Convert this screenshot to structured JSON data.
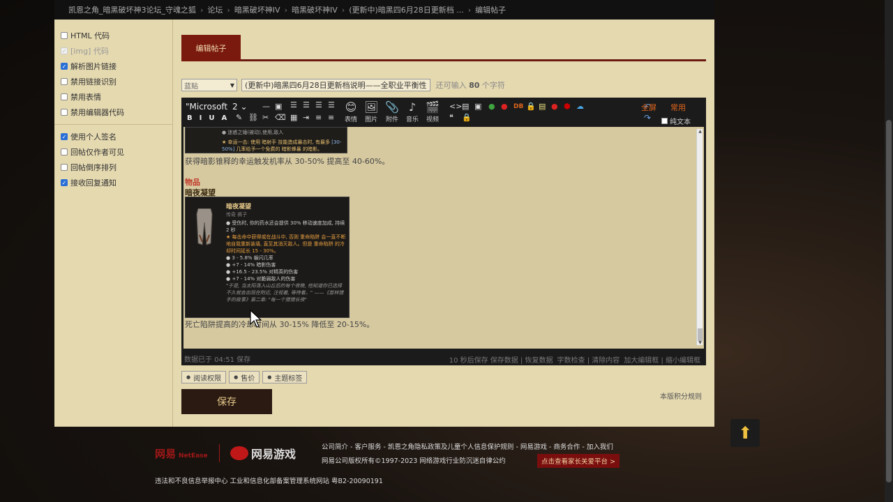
{
  "breadcrumb": {
    "items": [
      "凯恩之角_暗黑破坏神3论坛_守魂之狐",
      "论坛",
      "暗黑破坏神IV",
      "暗黑破坏神IV",
      "(更新中)暗黑四6月28日更新档 ...",
      "编辑帖子"
    ],
    "sep": "›"
  },
  "sidebar": {
    "options1": [
      {
        "label": "HTML 代码",
        "checked": false,
        "disabled": false
      },
      {
        "label": "[img] 代码",
        "checked": true,
        "disabled": true
      },
      {
        "label": "解析图片链接",
        "checked": true,
        "disabled": false
      },
      {
        "label": "禁用链接识别",
        "checked": false,
        "disabled": false
      },
      {
        "label": "禁用表情",
        "checked": false,
        "disabled": false
      },
      {
        "label": "禁用编辑器代码",
        "checked": false,
        "disabled": false
      }
    ],
    "options2": [
      {
        "label": "使用个人签名",
        "checked": true,
        "disabled": false
      },
      {
        "label": "回帖仅作者可见",
        "checked": false,
        "disabled": false
      },
      {
        "label": "回帖倒序排列",
        "checked": false,
        "disabled": false
      },
      {
        "label": "接收回复通知",
        "checked": true,
        "disabled": false
      }
    ]
  },
  "tab": {
    "label": "编辑帖子"
  },
  "subject": {
    "category": "蓝贴",
    "title": "(更新中)暗黑四6月28日更新档说明——全职业平衡性",
    "remain_prefix": "还可输入",
    "remain_count": "80",
    "remain_suffix": "个字符"
  },
  "toolbar": {
    "font": "\"Microsoft",
    "size": "2",
    "format": [
      "B",
      "I",
      "U",
      "A"
    ],
    "icons": [
      {
        "label": "表情",
        "glyph": "😊",
        "icon": "emoji-icon"
      },
      {
        "label": "图片",
        "glyph": "🖼",
        "icon": "image-icon"
      },
      {
        "label": "附件",
        "glyph": "📎",
        "icon": "attachment-icon"
      },
      {
        "label": "音乐",
        "glyph": "♪",
        "icon": "music-icon"
      },
      {
        "label": "视频",
        "glyph": "🎬",
        "icon": "video-icon"
      }
    ],
    "small_labels": [
      "DB"
    ],
    "fullscreen": "全屏",
    "common": "常用",
    "plain_text": "纯文本"
  },
  "content": {
    "img1_line1": "● 迷惑之锤(被动),使用,敌人",
    "img1_line2_a": "★ 幸运一击: 使用 暗射手 技能造成暴击时, 有最多 ",
    "img1_line2_hl": "[30-50%]",
    "img1_line2_b": " 几率给予一个免费的 暗影蜂暴 的暗影。",
    "para1": "获得暗影锥释的幸运触发机率从 30-50% 提高至 40-60%。",
    "section": "物品",
    "item_name": "暗夜凝望",
    "img2_title": "暗夜凝望",
    "img2_sub": "传奇 裤子",
    "img2_lines": [
      {
        "t": "● 受伤时, 你的药水还会提供 30% 移动速度加成, 持续 2 秒",
        "c": "gy"
      },
      {
        "t": "★ 每击命中获得或在战斗中, 否则 重命陷阱 会一直不断地自我重新装填, 直至其消灭敌人。但是 重命陷阱 的冷却时间延长 15 - 30%。",
        "c": "o"
      },
      {
        "t": "● 3 - 5.8% 躲闪几率",
        "c": "gy"
      },
      {
        "t": "● +7 - 14% 暗影伤害",
        "c": "gy"
      },
      {
        "t": "● +16.5 - 23.5% 对精英的伤害",
        "c": "gy"
      },
      {
        "t": "● +7 - 14% 对脆弱敌人的伤害",
        "c": "gy"
      },
      {
        "t": "\"于是, 当太阳落入山丘后的每个夜晚, 他知道你已选择不久就会出现在附近, 注视着, 等待着。\" ——《苗林猎手的故事》第二章: \"每一个猎猎长夜\"",
        "c": "it"
      }
    ],
    "para2": "死亡陷阱提高的冷却时间从 30-15% 降低至 20-15%。"
  },
  "statusbar": {
    "saved": "数据已于 04:51 保存",
    "actions": [
      "10 秒后保存 保存数据 | 恢复数据",
      "字数检查 | 清除内容",
      "加大编辑框 | 缩小编辑框"
    ]
  },
  "perm_buttons": [
    "阅读权限",
    "售价",
    "主题标签"
  ],
  "save_label": "保存",
  "rules_link": "本版积分规则",
  "footer": {
    "netease_cn": "网易",
    "netease_en": "NetEase",
    "game_logo": "网易游戏",
    "links": "公司简介 - 客户服务 - 凯恩之角隐私政策及儿童个人信息保护规则 - 网易游戏 - 商务合作 - 加入我们",
    "copyright": "网易公司版权所有©1997-2023   网络游戏行业防沉迷自律公约",
    "parent": "点击查看家长关爱平台 >",
    "legal": "违法和不良信息举报中心   工业和信息化部备案管理系统网站 粤B2-20090191"
  },
  "colors": {
    "panel_bg": "#e5d9b0",
    "tab_active": "#7a1a0e",
    "editor_bg": "#1b1b1b",
    "accent_orange": "#e0651c"
  }
}
